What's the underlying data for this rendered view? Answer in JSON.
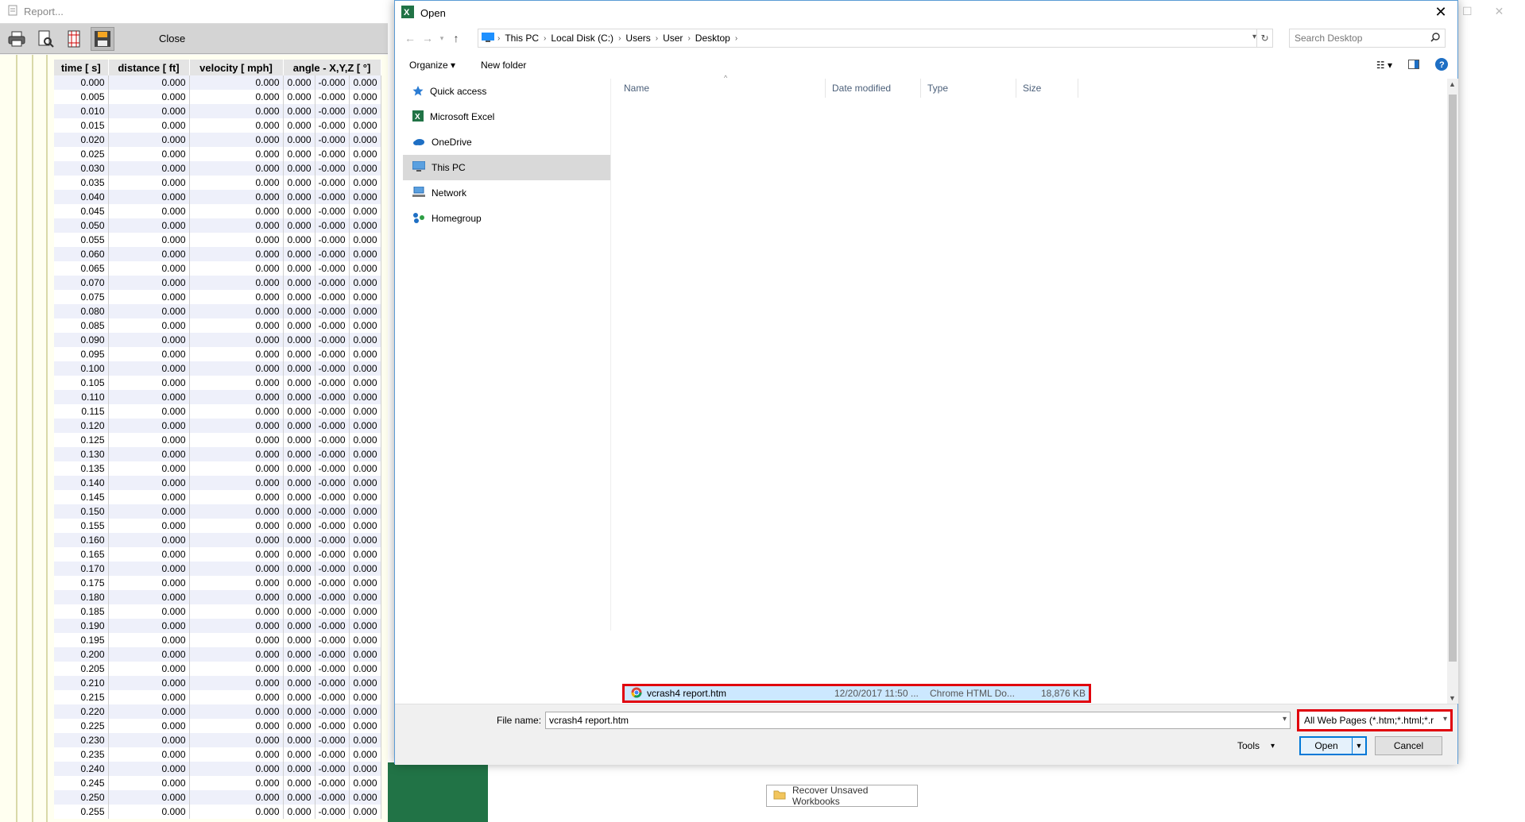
{
  "report": {
    "title": "Report...",
    "toolbar": {
      "close_label": "Close"
    },
    "headers": [
      "time [ s]",
      "distance [ ft]",
      "velocity [ mph]",
      "angle - X,Y,Z [ °]"
    ],
    "times": [
      "0.000",
      "0.005",
      "0.010",
      "0.015",
      "0.020",
      "0.025",
      "0.030",
      "0.035",
      "0.040",
      "0.045",
      "0.050",
      "0.055",
      "0.060",
      "0.065",
      "0.070",
      "0.075",
      "0.080",
      "0.085",
      "0.090",
      "0.095",
      "0.100",
      "0.105",
      "0.110",
      "0.115",
      "0.120",
      "0.125",
      "0.130",
      "0.135",
      "0.140",
      "0.145",
      "0.150",
      "0.155",
      "0.160",
      "0.165",
      "0.170",
      "0.175",
      "0.180",
      "0.185",
      "0.190",
      "0.195",
      "0.200",
      "0.205",
      "0.210",
      "0.215",
      "0.220",
      "0.225",
      "0.230",
      "0.235",
      "0.240",
      "0.245",
      "0.250",
      "0.255"
    ],
    "row_values": {
      "distance": "0.000",
      "velocity": "0.000",
      "angle_x": "0.000",
      "angle_y": "-0.000",
      "angle_z": "0.000"
    }
  },
  "dialog": {
    "title": "Open",
    "breadcrumb": [
      "This PC",
      "Local Disk (C:)",
      "Users",
      "User",
      "Desktop"
    ],
    "search_placeholder": "Search Desktop",
    "organize_label": "Organize",
    "new_folder_label": "New folder",
    "nav_items": [
      {
        "label": "Quick access",
        "icon": "star-icon"
      },
      {
        "label": "Microsoft Excel",
        "icon": "excel-icon"
      },
      {
        "label": "OneDrive",
        "icon": "cloud-icon"
      },
      {
        "label": "This PC",
        "icon": "computer-icon"
      },
      {
        "label": "Network",
        "icon": "network-icon"
      },
      {
        "label": "Homegroup",
        "icon": "homegroup-icon"
      }
    ],
    "columns": [
      "Name",
      "Date modified",
      "Type",
      "Size"
    ],
    "file": {
      "name": "vcrash4 report.htm",
      "date": "12/20/2017 11:50 ...",
      "type": "Chrome HTML Do...",
      "size": "18,876 KB"
    },
    "file_name_label": "File name:",
    "file_name_value": "vcrash4 report.htm",
    "filter_value": "All Web Pages (*.htm;*.html;*.r",
    "tools_label": "Tools",
    "open_label": "Open",
    "cancel_label": "Cancel"
  },
  "excel": {
    "recover_label": "Recover Unsaved Workbooks",
    "accent": "#217346"
  },
  "colors": {
    "highlight_red": "#e0000c",
    "selection_blue": "#cce8ff",
    "primary_blue": "#0078d7"
  }
}
